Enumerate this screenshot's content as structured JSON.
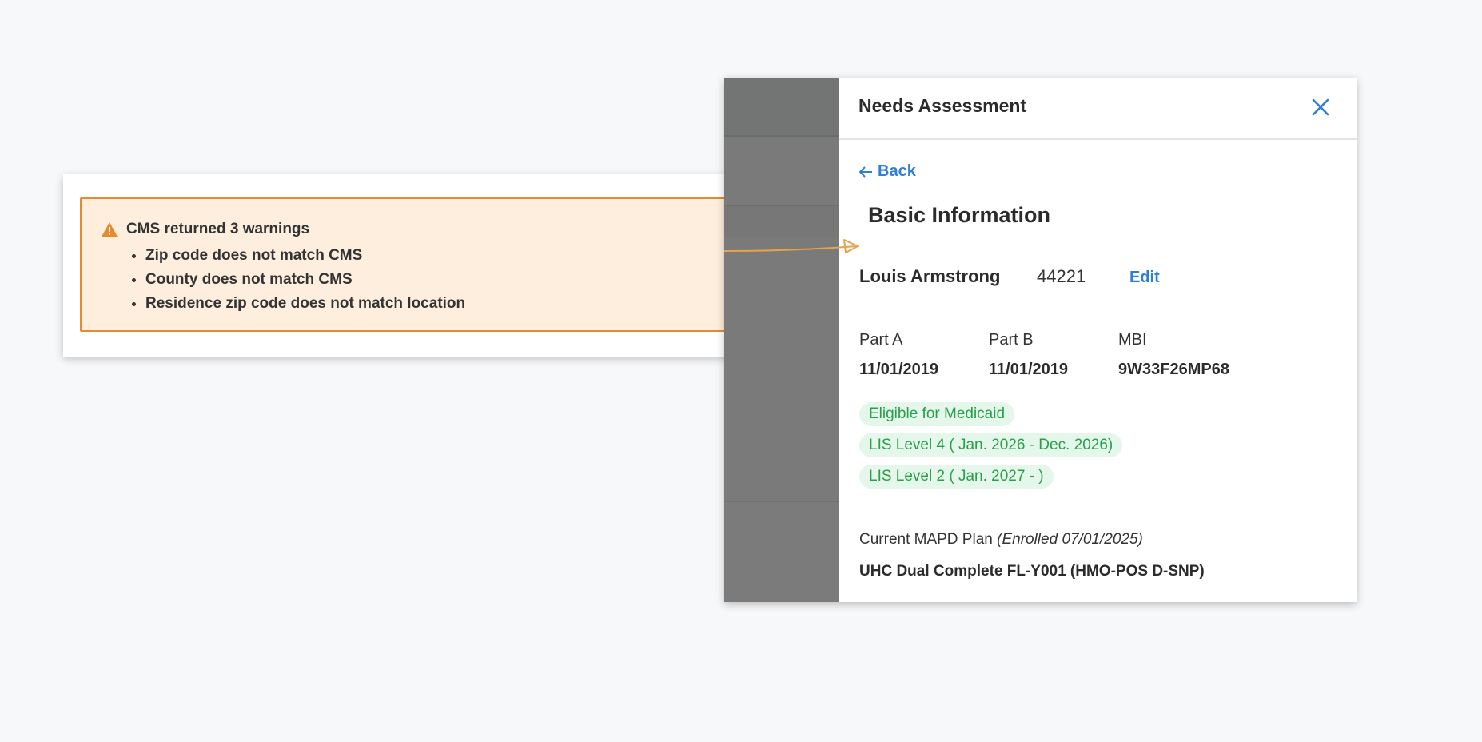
{
  "warning": {
    "title": "CMS returned 3 warnings",
    "items": [
      "Zip code does not match CMS",
      "County does not match CMS",
      "Residence zip code does not match location"
    ],
    "icon": "warning-triangle-icon",
    "colors": {
      "border": "#e38b2e",
      "background": "#fdeedd"
    }
  },
  "drawer": {
    "title": "Needs Assessment",
    "back_label": "Back",
    "section_title": "Basic Information",
    "member": {
      "name": "Louis Armstrong",
      "zip": "44221",
      "edit_label": "Edit"
    },
    "fields": [
      {
        "label": "Part A",
        "value": "11/01/2019"
      },
      {
        "label": "Part B",
        "value": "11/01/2019"
      },
      {
        "label": "MBI",
        "value": "9W33F26MP68"
      }
    ],
    "tags": [
      "Eligible for Medicaid",
      "LIS Level 4 ( Jan. 2026 - Dec. 2026)",
      "LIS Level 2 ( Jan. 2027 - )"
    ],
    "plan": {
      "label": "Current MAPD Plan",
      "enrolled": "(Enrolled 07/01/2025)",
      "value": "UHC Dual Complete FL-Y001 (HMO-POS D-SNP)"
    },
    "colors": {
      "link": "#2f7fd4",
      "tag_text": "#27a04a",
      "tag_bg": "#e5f6ea"
    }
  }
}
